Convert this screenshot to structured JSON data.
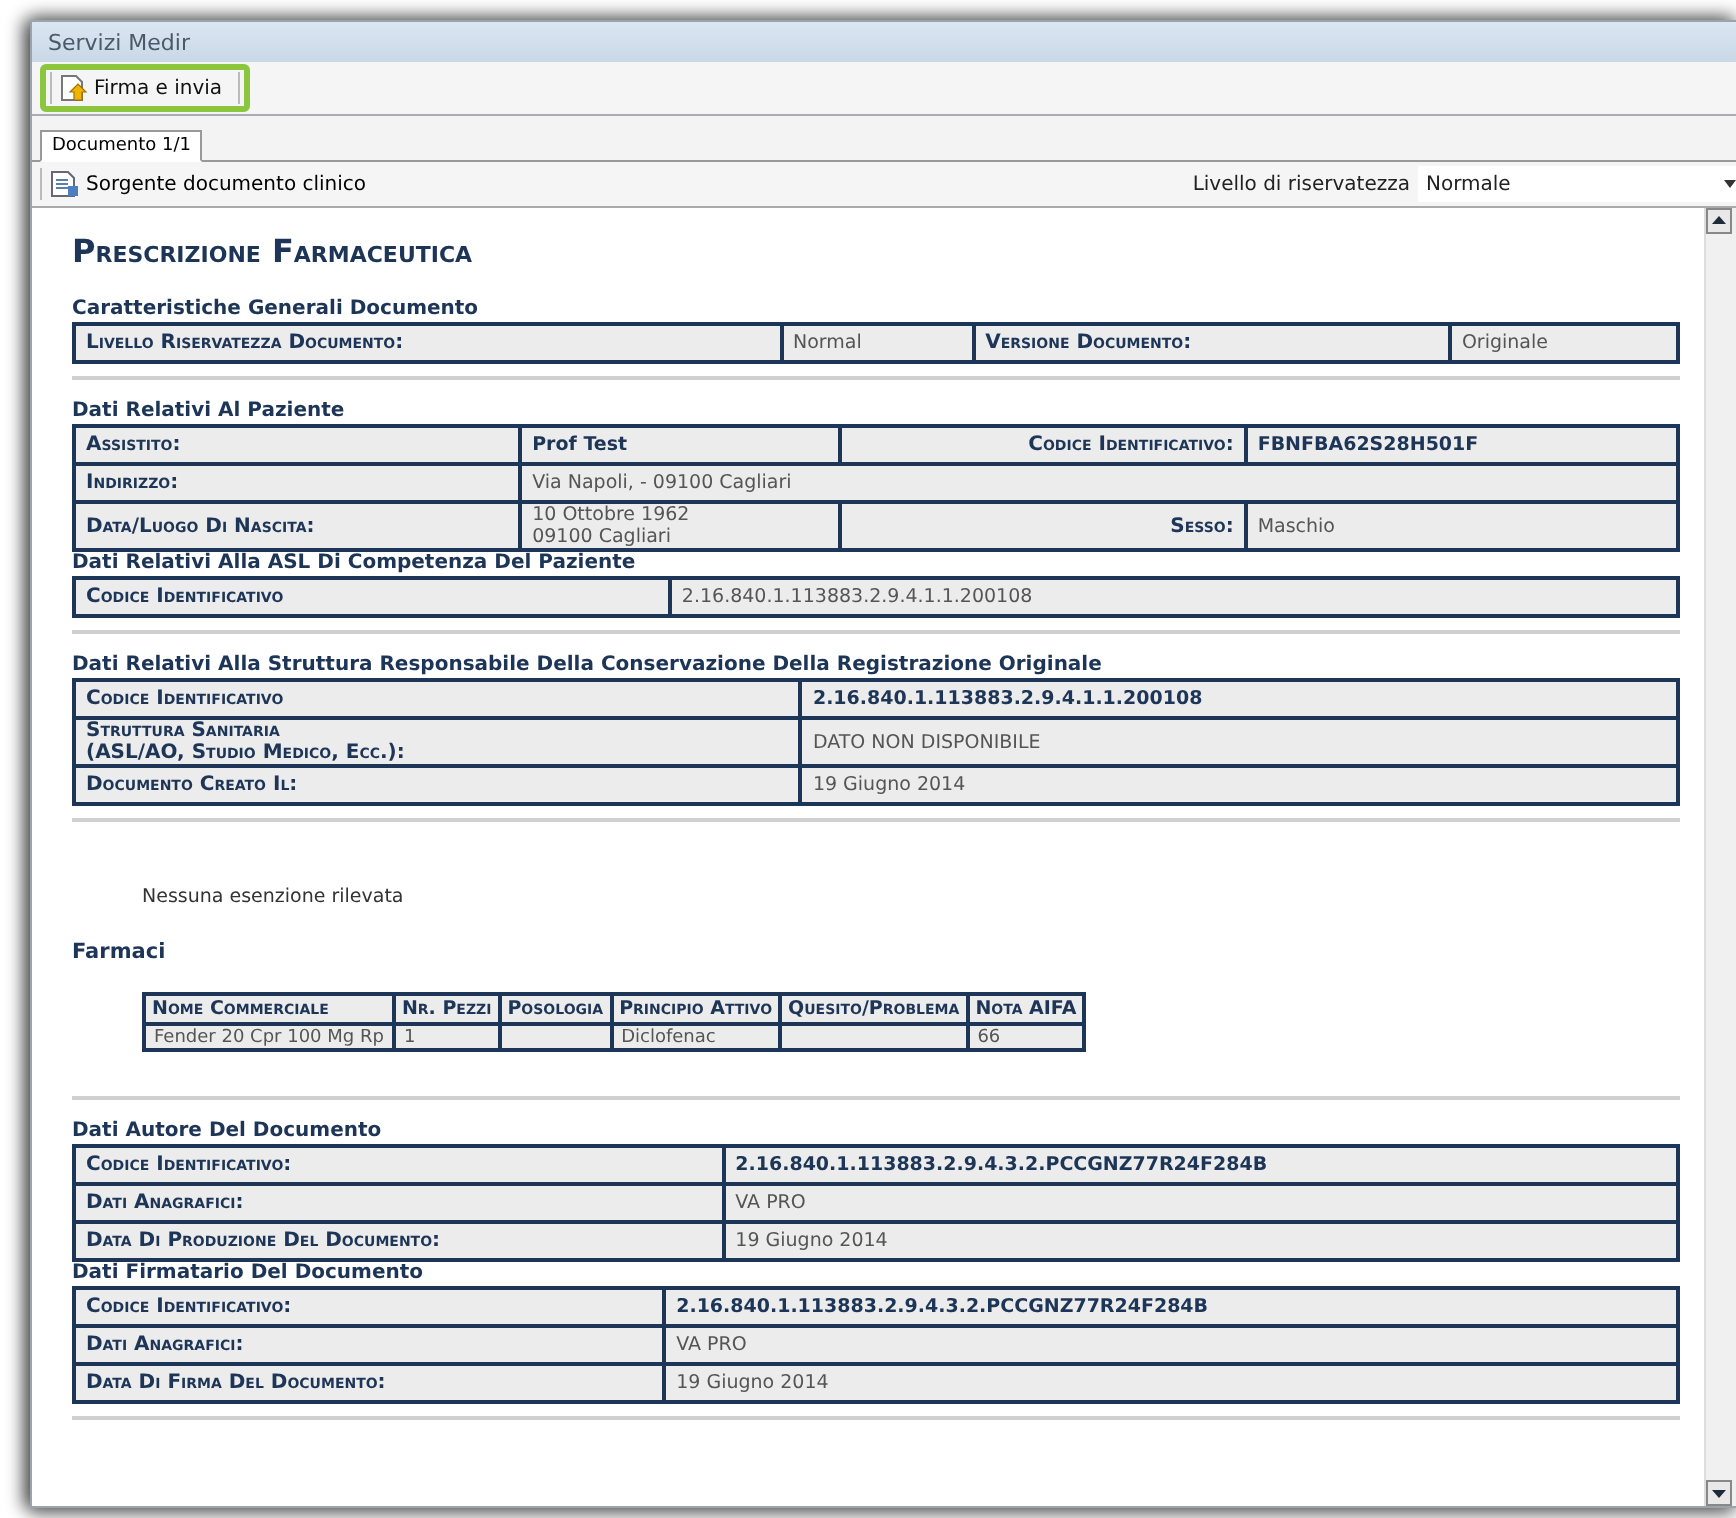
{
  "window": {
    "title": "Servizi Medir"
  },
  "toolbar": {
    "button": "Firma e invia"
  },
  "tabs": [
    {
      "label": "Documento 1/1",
      "selected": true
    }
  ],
  "doc_toolbar": {
    "source_button": "Sorgente documento clinico",
    "privacy_label": "Livello di riservatezza",
    "privacy_value": "Normale"
  },
  "document": {
    "title": "Prescrizione Farmaceutica",
    "blocks": [
      {
        "kind": "section",
        "title": "Caratteristiche Generali Documento",
        "rows": [
          [
            {
              "kind": "label",
              "text": "Livello Riservatezza Documento:"
            },
            {
              "kind": "value",
              "text": "Normal"
            },
            {
              "kind": "label",
              "text": "Versione Documento:"
            },
            {
              "kind": "value",
              "text": "Originale"
            }
          ]
        ]
      },
      {
        "kind": "rule"
      },
      {
        "kind": "section",
        "title": "Dati Relativi Al Paziente",
        "rows": [
          [
            {
              "kind": "label",
              "text": "Assistito:"
            },
            {
              "kind": "strong",
              "text": "Prof Test"
            },
            {
              "kind": "label_right",
              "text": "Codice Identificativo:"
            },
            {
              "kind": "strong",
              "text": "FBNFBA62S28H501F"
            }
          ],
          [
            {
              "kind": "label",
              "text": "Indirizzo:"
            },
            {
              "kind": "value",
              "text": "Via Napoli, - 09100 Cagliari",
              "colspan": 3
            }
          ],
          [
            {
              "kind": "label",
              "text": "Data/Luogo Di Nascita:"
            },
            {
              "kind": "value",
              "text": "10 Ottobre 1962\n09100 Cagliari"
            },
            {
              "kind": "label_right",
              "text": "Sesso:"
            },
            {
              "kind": "value",
              "text": "Maschio"
            }
          ]
        ]
      },
      {
        "kind": "section",
        "title": "Dati Relativi Alla ASL Di Competenza Del Paziente",
        "rows": [
          [
            {
              "kind": "label",
              "text": "Codice Identificativo"
            },
            {
              "kind": "value",
              "text": "2.16.840.1.113883.2.9.4.1.1.200108"
            }
          ]
        ]
      },
      {
        "kind": "rule"
      },
      {
        "kind": "section",
        "title": "Dati Relativi Alla Struttura Responsabile Della Conservazione Della Registrazione Originale",
        "rows": [
          [
            {
              "kind": "label",
              "text": "Codice Identificativo"
            },
            {
              "kind": "strong",
              "text": "2.16.840.1.113883.2.9.4.1.1.200108"
            }
          ],
          [
            {
              "kind": "label",
              "text": "Struttura Sanitaria\n(ASL/AO, Studio Medico, Ecc.):"
            },
            {
              "kind": "value",
              "text": "DATO NON DISPONIBILE"
            }
          ],
          [
            {
              "kind": "label",
              "text": "Documento Creato Il:"
            },
            {
              "kind": "value",
              "text": "19 Giugno 2014"
            }
          ]
        ]
      },
      {
        "kind": "rule"
      },
      {
        "kind": "note",
        "text": "Nessuna esenzione rilevata"
      },
      {
        "kind": "heading",
        "text": "Farmaci"
      },
      {
        "kind": "drug_table",
        "columns": [
          "Nome Commerciale",
          "Nr. Pezzi",
          "Posologia",
          "Principio Attivo",
          "Quesito/Problema",
          "Nota AIFA"
        ],
        "rows": [
          [
            "Fender 20 Cpr 100 Mg Rp",
            "1",
            "",
            "Diclofenac",
            "",
            "66"
          ]
        ]
      },
      {
        "kind": "rule"
      },
      {
        "kind": "section",
        "title": "Dati Autore Del Documento",
        "rows": [
          [
            {
              "kind": "label",
              "text": "Codice Identificativo:"
            },
            {
              "kind": "strong",
              "text": "2.16.840.1.113883.2.9.4.3.2.PCCGNZ77R24F284B"
            }
          ],
          [
            {
              "kind": "label",
              "text": "Dati Anagrafici:"
            },
            {
              "kind": "value",
              "text": "VA PRO"
            }
          ],
          [
            {
              "kind": "label",
              "text": "Data Di Produzione Del Documento:"
            },
            {
              "kind": "value",
              "text": "19 Giugno 2014"
            }
          ]
        ]
      },
      {
        "kind": "section",
        "title": "Dati Firmatario Del Documento",
        "rows": [
          [
            {
              "kind": "label",
              "text": "Codice Identificativo:"
            },
            {
              "kind": "strong",
              "text": "2.16.840.1.113883.2.9.4.3.2.PCCGNZ77R24F284B"
            }
          ],
          [
            {
              "kind": "label",
              "text": "Dati Anagrafici:"
            },
            {
              "kind": "value",
              "text": "VA PRO"
            }
          ],
          [
            {
              "kind": "label",
              "text": "Data Di Firma Del Documento:"
            },
            {
              "kind": "value",
              "text": "19 Giugno 2014"
            }
          ]
        ]
      },
      {
        "kind": "rule"
      }
    ]
  }
}
